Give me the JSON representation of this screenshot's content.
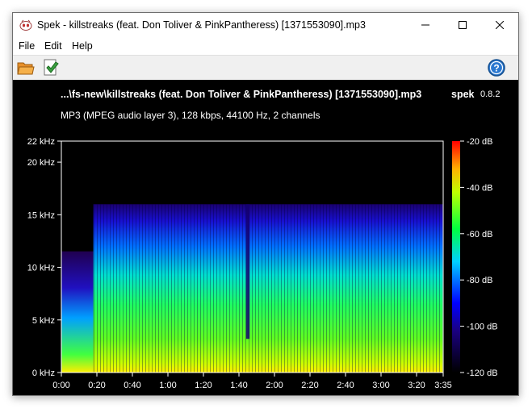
{
  "window": {
    "title": "Spek - killstreaks (feat. Don Toliver & PinkPantheress) [1371553090].mp3",
    "minimize_icon": "minimize-icon",
    "maximize_icon": "maximize-icon",
    "close_icon": "close-icon",
    "app_icon": "spek-app-icon"
  },
  "menu": {
    "items": [
      {
        "label": "File"
      },
      {
        "label": "Edit"
      },
      {
        "label": "Help"
      }
    ]
  },
  "toolbar": {
    "open_icon": "folder-open-icon",
    "save_icon": "save-icon",
    "help_icon": "help-icon"
  },
  "header": {
    "file_title": "...\\fs-new\\killstreaks (feat. Don Toliver & PinkPantheress) [1371553090].mp3",
    "app_name": "spek",
    "app_version": "0.8.2",
    "file_info": "MP3 (MPEG audio layer 3), 128 kbps, 44100 Hz, 2 channels"
  },
  "chart_data": {
    "type": "heatmap",
    "x_ticks": [
      "0:00",
      "0:20",
      "0:40",
      "1:00",
      "1:20",
      "1:40",
      "2:00",
      "2:20",
      "2:40",
      "3:00",
      "3:20",
      "3:35"
    ],
    "x_tick_seconds": [
      0,
      20,
      40,
      60,
      80,
      100,
      120,
      140,
      160,
      180,
      200,
      215
    ],
    "xlim_seconds": [
      0,
      215
    ],
    "y_ticks": [
      "0 kHz",
      "5 kHz",
      "10 kHz",
      "15 kHz",
      "20 kHz",
      "22 kHz"
    ],
    "y_tick_khz": [
      0,
      5,
      10,
      15,
      20,
      22
    ],
    "ylim_khz": [
      0,
      22
    ],
    "colorbar_ticks": [
      "-20 dB",
      "-40 dB",
      "-60 dB",
      "-80 dB",
      "-100 dB",
      "-120 dB"
    ],
    "colorbar_db": [
      -20,
      -40,
      -60,
      -80,
      -100,
      -120
    ],
    "colorbar_range_db": [
      -120,
      -20
    ],
    "colorbar_colors": [
      "#ff0000",
      "#ffff00",
      "#00ff00",
      "#00ffff",
      "#0000ff",
      "#000000"
    ],
    "cutoff_khz": 16,
    "intro_end_seconds": 18,
    "dip_seconds": [
      104,
      106
    ]
  }
}
